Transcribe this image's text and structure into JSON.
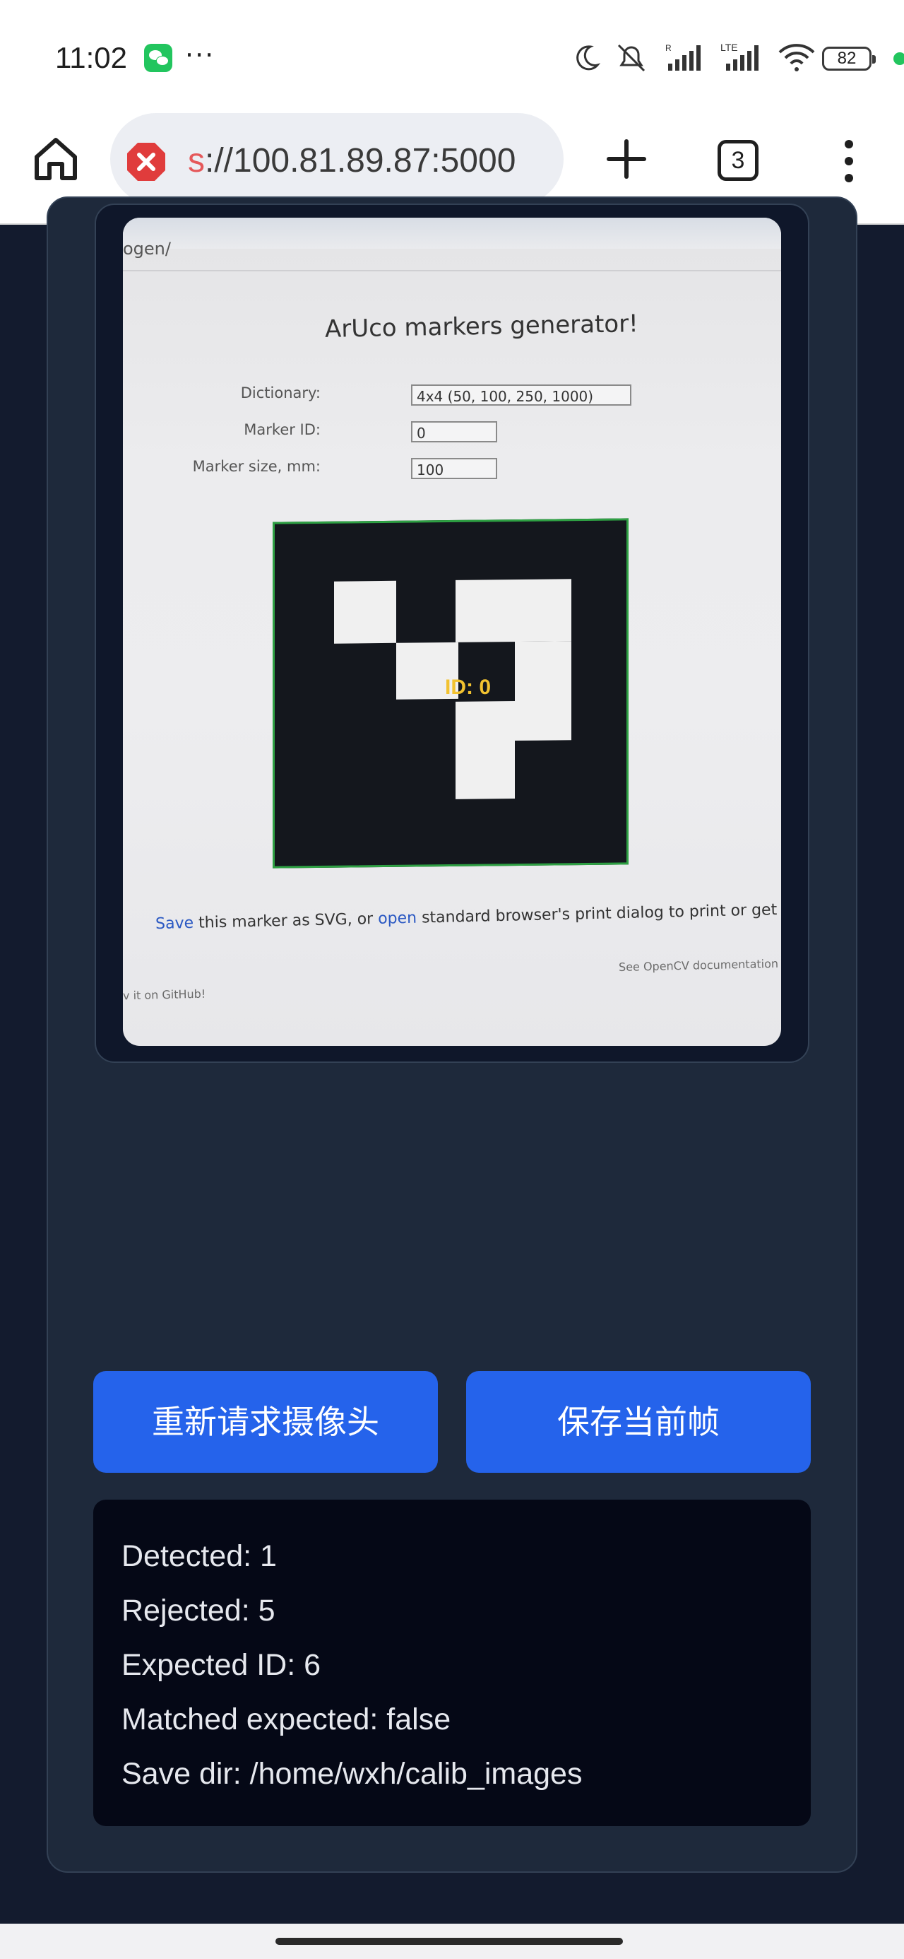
{
  "status_bar": {
    "time": "11:02",
    "extra": "···",
    "battery": "82",
    "icons": [
      "wechat-icon",
      "moon-icon",
      "mute-icon",
      "signal-icon",
      "lte-signal-icon",
      "wifi-icon",
      "battery-icon"
    ]
  },
  "browser": {
    "url_scheme": "s",
    "url_rest": "://100.81.89.87:5000",
    "tab_count": "3"
  },
  "camera": {
    "path_text": "ogen/",
    "page_title": "ArUco markers generator!",
    "dictionary_label": "Dictionary:",
    "dictionary_value": "4x4 (50, 100, 250, 1000)",
    "marker_id_label": "Marker ID:",
    "marker_id_value": "0",
    "marker_size_label": "Marker size, mm:",
    "marker_size_value": "100",
    "detected_label": "ID: 0",
    "save_link": "Save",
    "save_mid": " this marker as SVG, or ",
    "open_link": "open",
    "save_end": " standard browser's print dialog to print or get the PDF.",
    "docs_text": "See OpenCV documentation to le",
    "github_text": "v it on GitHub!"
  },
  "buttons": {
    "retry": "重新请求摄像头",
    "save": "保存当前帧"
  },
  "info": {
    "detected": "Detected: 1",
    "rejected": "Rejected: 5",
    "expected_id": "Expected ID: 6",
    "matched": "Matched expected: false",
    "save_dir": "Save dir: /home/wxh/calib_images"
  },
  "colors": {
    "primary": "#2563eb",
    "background": "#131b2e",
    "card": "#1e293b",
    "insecure": "#e03c3c"
  }
}
